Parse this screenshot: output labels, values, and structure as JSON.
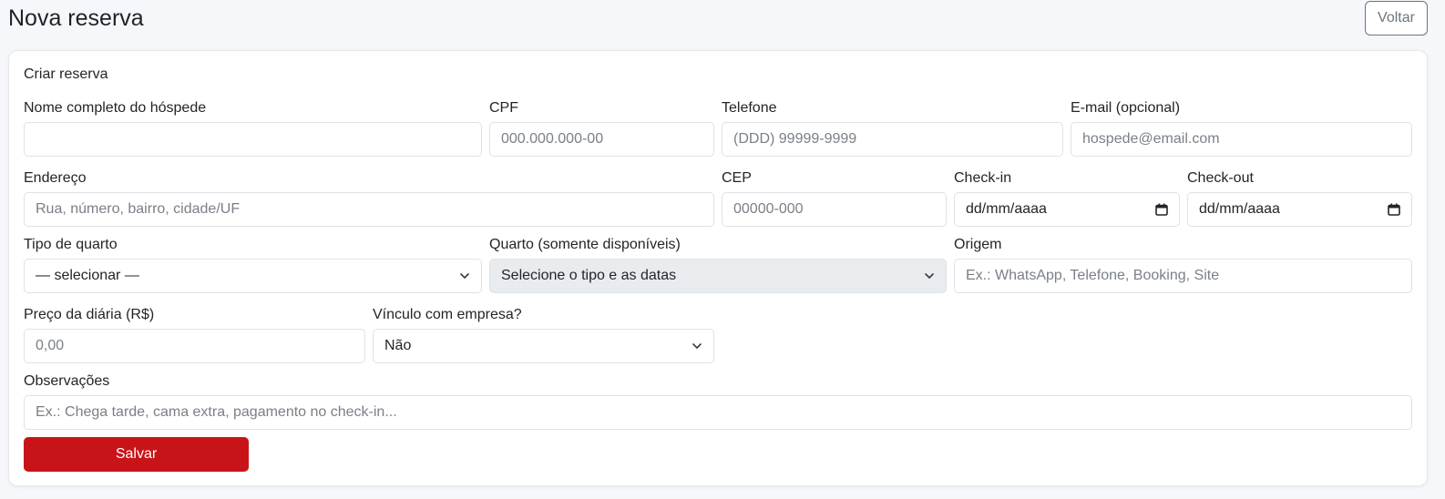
{
  "page": {
    "title": "Nova reserva",
    "back_label": "Voltar"
  },
  "form": {
    "card_title": "Criar reserva",
    "guest_name": {
      "label": "Nome completo do hóspede",
      "value": "",
      "placeholder": ""
    },
    "cpf": {
      "label": "CPF",
      "placeholder": "000.000.000-00"
    },
    "phone": {
      "label": "Telefone",
      "placeholder": "(DDD) 99999-9999"
    },
    "email": {
      "label": "E-mail (opcional)",
      "placeholder": "hospede@email.com"
    },
    "address": {
      "label": "Endereço",
      "placeholder": "Rua, número, bairro, cidade/UF"
    },
    "cep": {
      "label": "CEP",
      "placeholder": "00000-000"
    },
    "checkin": {
      "label": "Check-in",
      "value": "dd/mm/aaaa"
    },
    "checkout": {
      "label": "Check-out",
      "value": "dd/mm/aaaa"
    },
    "room_type": {
      "label": "Tipo de quarto",
      "selected": "— selecionar —"
    },
    "room": {
      "label": "Quarto (somente disponíveis)",
      "selected": "Selecione o tipo e as datas"
    },
    "origin": {
      "label": "Origem",
      "placeholder": "Ex.: WhatsApp, Telefone, Booking, Site"
    },
    "daily_price": {
      "label": "Preço da diária (R$)",
      "placeholder": "0,00"
    },
    "company_link": {
      "label": "Vínculo com empresa?",
      "selected": "Não"
    },
    "notes": {
      "label": "Observações",
      "placeholder": "Ex.: Chega tarde, cama extra, pagamento no check-in..."
    },
    "save_label": "Salvar"
  },
  "colors": {
    "primary": "#c81418",
    "disabled_bg": "#e9ecef",
    "border": "#dee2e6"
  }
}
